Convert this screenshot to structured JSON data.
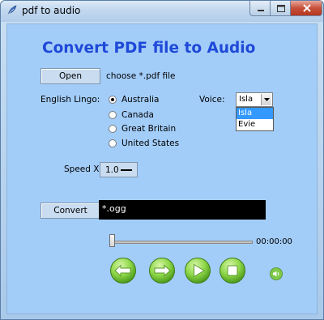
{
  "window": {
    "title": "pdf to audio"
  },
  "heading": "Convert PDF file to Audio",
  "open_section": {
    "open_label": "Open",
    "choose_label": "choose *.pdf file"
  },
  "lingo": {
    "label": "English Lingo:",
    "options": [
      "Australia",
      "Canada",
      "Great Britain",
      "United States"
    ],
    "selected": "Australia"
  },
  "voice": {
    "label": "Voice:",
    "selected": "Isla",
    "options": [
      "Isla",
      "Evie"
    ]
  },
  "speed": {
    "label": "Speed X",
    "value": "1.0"
  },
  "convert": {
    "label": "Convert",
    "output": "*.ogg"
  },
  "player": {
    "time": "00:00:00",
    "position": 0,
    "buttons": [
      "rewind-icon",
      "forward-icon",
      "play-icon",
      "stop-icon"
    ],
    "volume_icon": "speaker-icon"
  },
  "colors": {
    "heading": "#1e49d8",
    "background": "#a3cdf9",
    "entry_bg": "#000000",
    "accent_green": "#7fd63a",
    "highlight": "#3399ff"
  }
}
